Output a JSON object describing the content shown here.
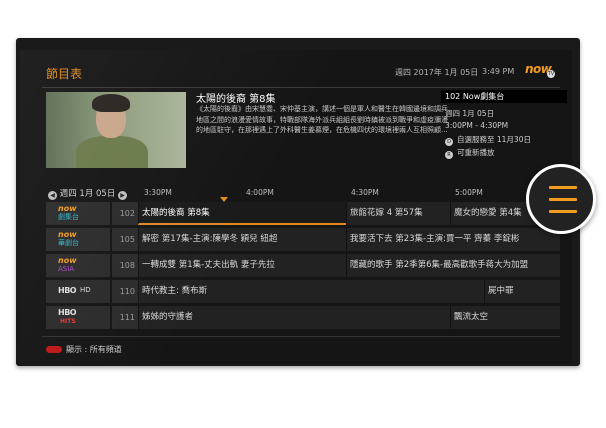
{
  "header": {
    "title": "節目表",
    "date": "週四 2017年 1月 05日",
    "time": "3:49 PM",
    "logo": "now",
    "logo_mark": "TV"
  },
  "featured": {
    "title": "太陽的後裔 第8集",
    "description": "《太陽的後裔》由宋慧喬、宋仲基主演，講述一個是軍人和醫生在韓國邊境和調兵地區之間的浪漫愛情故事，特戰部隊海外派兵組組長劉時鎮被派到戰爭和虛疫瀰漫的地區駐守，在那裡遇上了外科醫生姜慕煙，在危機四伏的環境裡兩人互相照顧..."
  },
  "info_panel": {
    "channel": "102 Now劇集台",
    "date": "週四 1月 05日",
    "time_range": "3:00PM - 4:30PM",
    "autoplay": "自選服務至 11月30日",
    "replay": "可重新播放",
    "autoplay_icon": "D",
    "replay_icon": "R"
  },
  "timeline": {
    "date": "週四 1月 05日",
    "times": [
      "3:30PM",
      "4:00PM",
      "4:30PM",
      "5:00PM"
    ]
  },
  "channels": [
    {
      "logo": "now",
      "logo_sub": "劇集台",
      "number": "102",
      "programs": [
        {
          "title": "太陽的後裔 第8集",
          "selected": true
        },
        {
          "title": "旅館花嫁 4 第57集"
        },
        {
          "title": "魔女的戀愛 第4集"
        }
      ]
    },
    {
      "logo": "now",
      "logo_sub": "華劇台",
      "number": "105",
      "programs": [
        {
          "title": "解密 第17集-主演:陳學冬 穎兒 紐超"
        },
        {
          "title": "我要活下去 第23集-主演:賈一平 齊蓁 李錠彬"
        }
      ]
    },
    {
      "logo": "now",
      "logo_sub": "ASIA",
      "number": "108",
      "programs": [
        {
          "title": "一轉成雙 第1集-丈夫出軌 妻子先拉"
        },
        {
          "title": "隱藏的歌手 第2季第6集-最高歡歌手蒋大为加盟"
        }
      ]
    },
    {
      "logo": "HBO",
      "logo_sub": "HD",
      "number": "110",
      "programs": [
        {
          "title": "時代教主: 喬布斯"
        },
        {
          "title": "屍中罪"
        }
      ]
    },
    {
      "logo": "HBO",
      "logo_sub": "HITS",
      "number": "111",
      "programs": [
        {
          "title": "姊姊的守護者"
        },
        {
          "title": "飄流太空"
        }
      ]
    }
  ],
  "footer": {
    "legend": "顯示 : 所有頻道"
  },
  "menu_button": {
    "icon": "hamburger-menu-icon"
  },
  "colors": {
    "accent": "#e08a1e",
    "screen_bg": "#151515",
    "legend_red": "#c01818"
  }
}
